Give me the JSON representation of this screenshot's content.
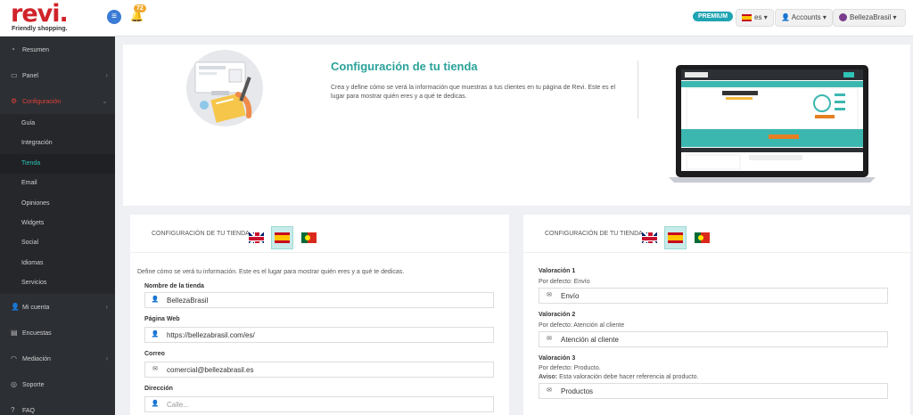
{
  "header": {
    "brand": "revi.",
    "tagline": "Friendly shopping.",
    "notification_count": "72",
    "premium_badge": "PREMIUM",
    "language": "es",
    "accounts": "Accounts",
    "user": "BellezaBrasil"
  },
  "sidebar": {
    "items": [
      {
        "label": "Resumen",
        "icon": "dashboard-icon"
      },
      {
        "label": "Panel",
        "icon": "laptop-icon"
      },
      {
        "label": "Configuración",
        "icon": "gear-icon"
      }
    ],
    "config_sub": [
      "Guía",
      "Integración",
      "Tienda",
      "Email",
      "Opiniones",
      "Widgets",
      "Social",
      "Idiomas",
      "Servicios"
    ],
    "bottom_items": [
      {
        "label": "Mi cuenta",
        "icon": "user-icon"
      },
      {
        "label": "Encuestas",
        "icon": "book-icon"
      },
      {
        "label": "Mediación",
        "icon": "rss-icon"
      },
      {
        "label": "Soporte",
        "icon": "lifebuoy-icon"
      },
      {
        "label": "FAQ",
        "icon": "question-icon"
      }
    ]
  },
  "banner": {
    "title": "Configuración de tu tienda",
    "description": "Crea y define cómo se verá la información que muestras a tus clientes en tu página de Revi. Este es el lugar para mostrar quién eres y a qué te dedicas."
  },
  "left_card": {
    "heading": "CONFIGURACIÓN DE TU TIENDA",
    "intro": "Define cómo se verá tu información. Este es el lugar para mostrar quién eres y a qué te dedicas.",
    "fields": [
      {
        "label": "Nombre de la tienda",
        "value": "BellezaBrasil",
        "placeholder": ""
      },
      {
        "label": "Página Web",
        "value": "https://bellezabrasil.com/es/",
        "placeholder": ""
      },
      {
        "label": "Correo",
        "value": "comercial@bellezabrasil.es",
        "placeholder": ""
      },
      {
        "label": "Dirección",
        "value": "",
        "placeholder": "Calle..."
      }
    ]
  },
  "right_card": {
    "heading": "CONFIGURACIÓN DE TU TIENDA",
    "ratings": [
      {
        "label": "Valoración 1",
        "default": "Por defecto: Envío",
        "value": "Envío"
      },
      {
        "label": "Valoración 2",
        "default": "Por defecto: Atención al cliente",
        "value": "Atención al cliente"
      },
      {
        "label": "Valoración 3",
        "default": "Por defecto: Producto.",
        "warning_label": "Aviso:",
        "warning": "Esta valoración debe hacer referencia al producto.",
        "value": "Productos"
      }
    ]
  },
  "colors": {
    "accent": "#2aa39a",
    "brand": "#d0232a",
    "sidebar": "#2c2f34",
    "premium": "#1fa4b3"
  }
}
